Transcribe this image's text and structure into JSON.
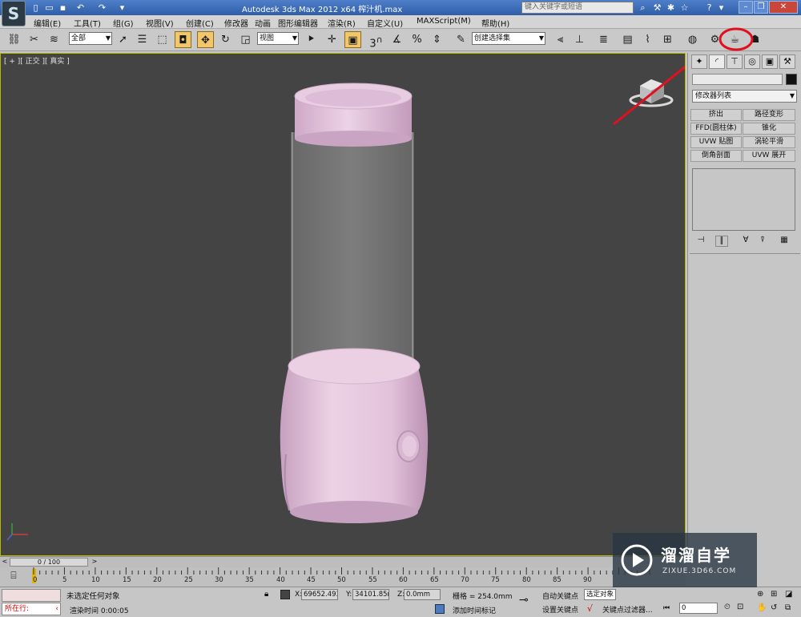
{
  "title_bar": {
    "title": "Autodesk 3ds Max  2012 x64      榨汁机.max",
    "search_placeholder": "键入关键字或短语"
  },
  "menu": [
    "编辑(E)",
    "工具(T)",
    "组(G)",
    "视图(V)",
    "创建(C)",
    "修改器",
    "动画",
    "图形编辑器",
    "渲染(R)",
    "自定义(U)",
    "MAXScript(M)",
    "帮助(H)"
  ],
  "toolbar": {
    "selection_filter": "全部",
    "reference_coord": "视图",
    "snap_label": "3",
    "named_selection": "创建选择集"
  },
  "viewport": {
    "label": "[ + ][ 正交 ][ 真实 ]"
  },
  "command_panel": {
    "modifier_list": "修改器列表",
    "modifier_buttons": [
      [
        "挤出",
        "路径变形"
      ],
      [
        "FFD(圆柱体)",
        "锥化"
      ],
      [
        "UVW 贴图",
        "涡轮平滑"
      ],
      [
        "倒角剖面",
        "UVW 展开"
      ]
    ]
  },
  "time_slider": {
    "frame_label": "0 / 100",
    "ticks": [
      "0",
      "5",
      "10",
      "15",
      "20",
      "25",
      "30",
      "35",
      "40",
      "45",
      "50",
      "55",
      "60",
      "65",
      "70",
      "75",
      "80",
      "85",
      "90"
    ]
  },
  "status": {
    "current_script": "所在行:",
    "prompt": "未选定任何对象",
    "render_time": "渲染时间  0:00:05",
    "x_label": "X:",
    "x_value": "69652.493",
    "y_label": "Y:",
    "y_value": "34101.85m",
    "z_label": "Z:",
    "z_value": "0.0mm",
    "grid": "栅格 = 254.0mm",
    "add_time_tag": "添加时间标记",
    "auto_key": "自动关键点",
    "selected": "选定对象",
    "set_key": "设置关键点",
    "key_filters": "关键点过滤器...",
    "frame_field": "0"
  },
  "watermark": {
    "brand": "溜溜自学",
    "url": "ZIXUE.3D66.COM"
  },
  "colors": {
    "viewport_bg": "#444444",
    "juicer_body": "#e3c3dc",
    "annotation": "#e01020",
    "titlebar": "#3b6cb9"
  }
}
